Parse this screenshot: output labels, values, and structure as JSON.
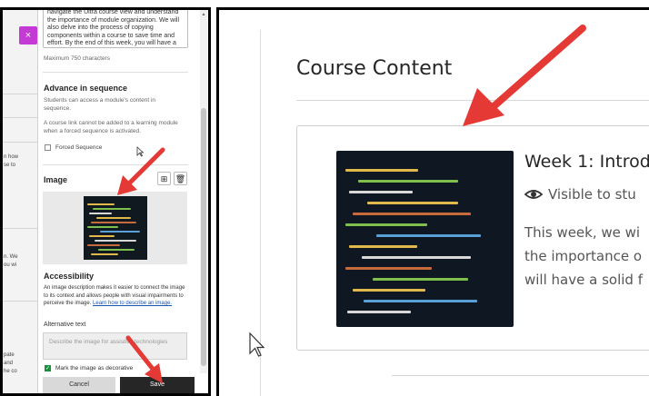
{
  "panel": {
    "close_icon": "×",
    "description_text": "navigate the Ultra course view and understand the importance of module organization. We will also delve into the process of copying components within a course to save time and effort. By the end of this week, you will have a",
    "max_chars": "Maximum 750 characters",
    "advance_heading": "Advance in sequence",
    "advance_desc": "Students can access a module's content in sequence.",
    "course_link_note": "A course link cannot be added to a learning module when a forced sequence is activated.",
    "forced_sequence_label": "Forced Sequence",
    "image_heading": "Image",
    "accessibility_heading": "Accessibility",
    "accessibility_desc": "An image description makes it easier to connect the image to its context and allows people with visual impairments to perceive the image.",
    "learn_link": "Learn how to describe an image.",
    "alt_text_label": "Alternative text",
    "alt_text_placeholder": "Describe the image for assistive technologies",
    "decorative_label": "Mark the image as decorative",
    "cancel_label": "Cancel",
    "save_label": "Save"
  },
  "background_snippets": [
    "n how",
    "se to",
    "n. We",
    "ou wi",
    "pate",
    "and",
    "he co"
  ],
  "main": {
    "page_title": "Course Content",
    "module_title": "Week 1: Introd",
    "visibility": "Visible to stu",
    "desc_lines": [
      "This week, we wi",
      "the importance o",
      "will have a solid f"
    ]
  },
  "colors": {
    "close_button": "#c33bd4",
    "save_button": "#262626",
    "arrow": "#e53935",
    "checkbox_checked": "#1a8f3c"
  }
}
